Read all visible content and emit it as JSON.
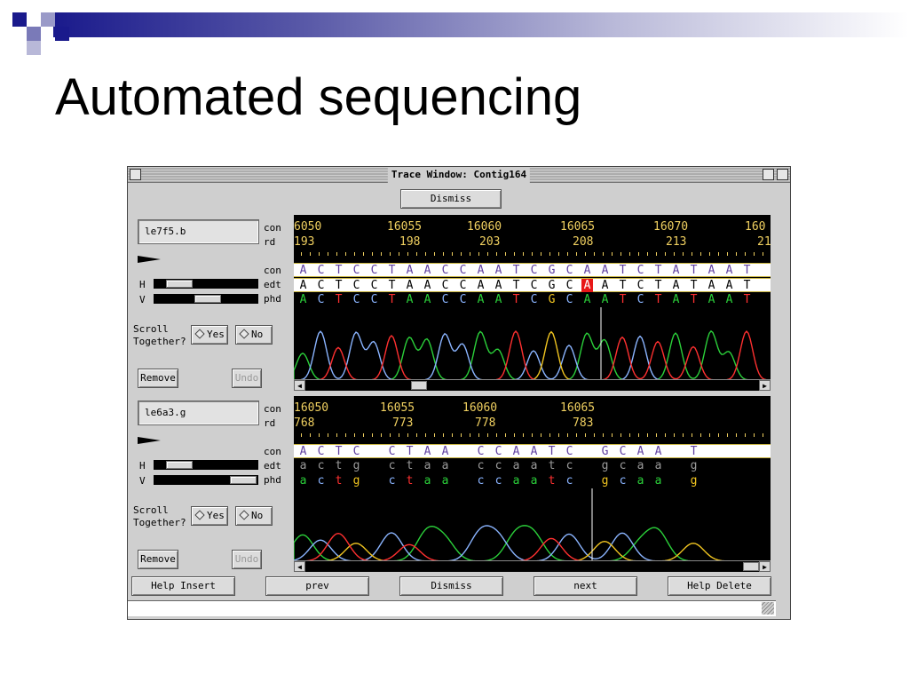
{
  "slide": {
    "title": "Automated sequencing"
  },
  "window": {
    "title": "Trace Window: Contig164",
    "top_button": "Dismiss",
    "bottom_buttons": [
      "Help Insert",
      "prev",
      "Dismiss",
      "next",
      "Help Delete"
    ]
  },
  "labels": {
    "con": "con",
    "rd": "rd",
    "edt": "edt",
    "phd": "phd",
    "H": "H",
    "V": "V",
    "scroll_together": [
      "Scroll",
      "Together?"
    ],
    "yes": "Yes",
    "no": "No",
    "remove": "Remove",
    "undo": "Undo"
  },
  "colors": {
    "A": "#2bd03a",
    "C": "#8ab4ff",
    "G": "#f0c420",
    "T": "#ff3030",
    "con_text": "#6040a0",
    "edt_text": "#000000",
    "highlight": "#e81818",
    "ruler": "#f0d060",
    "lower_text": "#9a9a9a"
  },
  "panels": [
    {
      "name": "le7f5.b",
      "con_positions": [
        "6050",
        "16055",
        "16060",
        "16065",
        "16070",
        "160"
      ],
      "rd_positions": [
        "193",
        "198",
        "203",
        "208",
        "213",
        "21"
      ],
      "con_seq": "A C T C C T A A C C A A T C G C A A T C T A T A A T",
      "edt_seq": "A C T C C T A A C C A A T C G C A A T C T A T A A T",
      "phd_seq": "A C T C C T A A C C A A T C G C A A T C T A T A A T",
      "highlight_index": 16
    },
    {
      "name": "le6a3.g",
      "con_positions": [
        "16050",
        "16055",
        "16060",
        "16065"
      ],
      "rd_positions": [
        "768",
        "773",
        "778",
        "783"
      ],
      "con_seq": "A C T C   C T A A   C C A A T C   G C A A   T",
      "edt_seq": "a c t g   c t a a   c c a a t c   g c a a   g",
      "phd_seq": "a c t g   c t a a   c c a a t c   g c a a   g"
    }
  ]
}
